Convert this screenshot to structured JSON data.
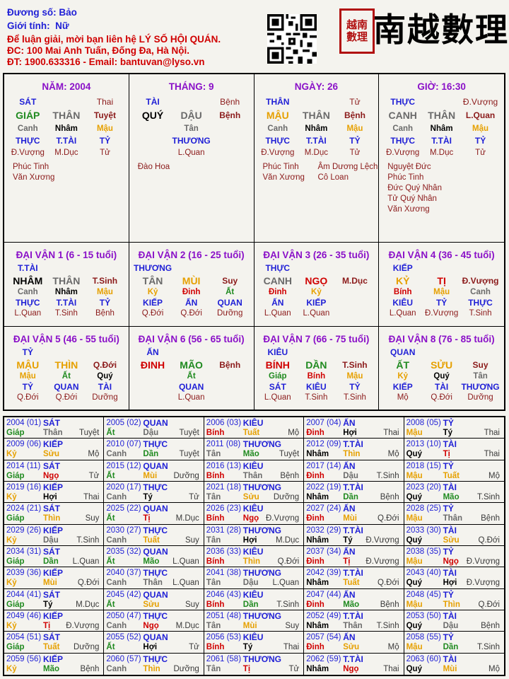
{
  "header": {
    "name_label": "Đương số:",
    "name": "Bảo",
    "gender_label": "Giới tính:",
    "gender": "Nữ",
    "contact1": "Để luận giải, mời bạn liên hệ LÝ SỐ HỘI QUÁN.",
    "contact2": "ĐC: 100 Mai Anh Tuấn, Đống Đa, Hà Nội.",
    "contact3": "ĐT: 1900.633316 - Email: bantuvan@lyso.vn",
    "brand": "南越數理",
    "seal": [
      "越南",
      "數理"
    ]
  },
  "pillars": [
    {
      "title": "NĂM: 2004",
      "row1": [
        {
          "t": "SÁT",
          "c": "c-blue b"
        },
        {
          "t": "",
          "c": ""
        },
        {
          "t": "Thai",
          "c": "c-maroon"
        }
      ],
      "row2": [
        {
          "t": "GIÁP",
          "c": "c-green b big"
        },
        {
          "t": "THÂN",
          "c": "c-gray b big"
        },
        {
          "t": "Tuyệt",
          "c": "c-maroon b"
        }
      ],
      "row3": [
        {
          "t": "Canh",
          "c": "c-gray b small"
        },
        {
          "t": "Nhâm",
          "c": "c-black b small"
        },
        {
          "t": "Mậu",
          "c": "c-orange b small"
        }
      ],
      "row4": [
        {
          "t": "THỰC",
          "c": "c-blue b"
        },
        {
          "t": "T.TÀI",
          "c": "c-blue b"
        },
        {
          "t": "TỶ",
          "c": "c-blue b"
        }
      ],
      "row5": [
        {
          "t": "Đ.Vượng",
          "c": "c-maroon small"
        },
        {
          "t": "M.Dục",
          "c": "c-maroon small"
        },
        {
          "t": "Tử",
          "c": "c-maroon small"
        }
      ],
      "stars_left": [
        "Phúc Tinh",
        "Văn Xương"
      ],
      "stars_right": []
    },
    {
      "title": "THÁNG: 9",
      "row1": [
        {
          "t": "TÀI",
          "c": "c-blue b"
        },
        {
          "t": "",
          "c": ""
        },
        {
          "t": "Bệnh",
          "c": "c-maroon"
        }
      ],
      "row2": [
        {
          "t": "QUÝ",
          "c": "c-black b big"
        },
        {
          "t": "DẬU",
          "c": "c-gray b big"
        },
        {
          "t": "Bệnh",
          "c": "c-maroon b"
        }
      ],
      "row3": [
        {
          "t": "",
          "c": ""
        },
        {
          "t": "Tân",
          "c": "c-gray b small"
        },
        {
          "t": "",
          "c": ""
        }
      ],
      "row4": [
        {
          "t": "",
          "c": ""
        },
        {
          "t": "THƯƠNG",
          "c": "c-blue b"
        },
        {
          "t": "",
          "c": ""
        }
      ],
      "row5": [
        {
          "t": "",
          "c": ""
        },
        {
          "t": "L.Quan",
          "c": "c-maroon small"
        },
        {
          "t": "",
          "c": ""
        }
      ],
      "stars_left": [
        "Đào Hoa"
      ],
      "stars_right": []
    },
    {
      "title": "NGÀY: 26",
      "row1": [
        {
          "t": "THÂN",
          "c": "c-blue b"
        },
        {
          "t": "",
          "c": ""
        },
        {
          "t": "Tử",
          "c": "c-maroon"
        }
      ],
      "row2": [
        {
          "t": "MẬU",
          "c": "c-orange b big"
        },
        {
          "t": "THÂN",
          "c": "c-gray b big"
        },
        {
          "t": "Bệnh",
          "c": "c-maroon b"
        }
      ],
      "row3": [
        {
          "t": "Canh",
          "c": "c-gray b small"
        },
        {
          "t": "Nhâm",
          "c": "c-black b small"
        },
        {
          "t": "Mậu",
          "c": "c-orange b small"
        }
      ],
      "row4": [
        {
          "t": "THỰC",
          "c": "c-blue b"
        },
        {
          "t": "T.TÀI",
          "c": "c-blue b"
        },
        {
          "t": "TỶ",
          "c": "c-blue b"
        }
      ],
      "row5": [
        {
          "t": "Đ.Vượng",
          "c": "c-maroon small"
        },
        {
          "t": "M.Dục",
          "c": "c-maroon small"
        },
        {
          "t": "Tử",
          "c": "c-maroon small"
        }
      ],
      "stars_left": [
        "Phúc Tinh",
        "Văn Xương"
      ],
      "stars_right": [
        "Âm Dương Lệch",
        "Cô Loan"
      ]
    },
    {
      "title": "GIỜ: 16:30",
      "row1": [
        {
          "t": "THỰC",
          "c": "c-blue b"
        },
        {
          "t": "",
          "c": ""
        },
        {
          "t": "Đ.Vượng",
          "c": "c-maroon"
        }
      ],
      "row2": [
        {
          "t": "CANH",
          "c": "c-gray b big"
        },
        {
          "t": "THÂN",
          "c": "c-gray b big"
        },
        {
          "t": "L.Quan",
          "c": "c-maroon b"
        }
      ],
      "row3": [
        {
          "t": "Canh",
          "c": "c-gray b small"
        },
        {
          "t": "Nhâm",
          "c": "c-black b small"
        },
        {
          "t": "Mậu",
          "c": "c-orange b small"
        }
      ],
      "row4": [
        {
          "t": "THỰC",
          "c": "c-blue b"
        },
        {
          "t": "T.TÀI",
          "c": "c-blue b"
        },
        {
          "t": "TỶ",
          "c": "c-blue b"
        }
      ],
      "row5": [
        {
          "t": "Đ.Vượng",
          "c": "c-maroon small"
        },
        {
          "t": "M.Dục",
          "c": "c-maroon small"
        },
        {
          "t": "Tử",
          "c": "c-maroon small"
        }
      ],
      "stars_left": [
        "Nguyệt Đức",
        "Phúc Tinh",
        "Đức Quý Nhân",
        "Tử Quý Nhân",
        "Văn Xương"
      ],
      "stars_right": []
    }
  ],
  "dai_van": [
    {
      "title": "ĐẠI VẬN 1 (6 - 15 tuổi)",
      "god": "T.TÀI",
      "row2": [
        {
          "t": "NHÂM",
          "c": "c-black b big"
        },
        {
          "t": "THÂN",
          "c": "c-gray b big"
        },
        {
          "t": "T.Sinh",
          "c": "c-maroon b"
        }
      ],
      "row3": [
        {
          "t": "Canh",
          "c": "c-gray b small"
        },
        {
          "t": "Nhâm",
          "c": "c-black b small"
        },
        {
          "t": "Mậu",
          "c": "c-orange b small"
        }
      ],
      "row4": [
        {
          "t": "THỰC",
          "c": "c-blue b"
        },
        {
          "t": "T.TÀI",
          "c": "c-blue b"
        },
        {
          "t": "TỶ",
          "c": "c-blue b"
        }
      ],
      "row5": [
        {
          "t": "L.Quan",
          "c": "c-maroon small"
        },
        {
          "t": "T.Sinh",
          "c": "c-maroon small"
        },
        {
          "t": "Bệnh",
          "c": "c-maroon small"
        }
      ]
    },
    {
      "title": "ĐẠI VẬN 2 (16 - 25 tuổi)",
      "god": "THƯƠNG",
      "row2": [
        {
          "t": "TÂN",
          "c": "c-gray b big"
        },
        {
          "t": "MÙI",
          "c": "c-orange b big"
        },
        {
          "t": "Suy",
          "c": "c-maroon b"
        }
      ],
      "row3": [
        {
          "t": "Kỷ",
          "c": "c-orange b small"
        },
        {
          "t": "Đinh",
          "c": "c-red b small"
        },
        {
          "t": "Ất",
          "c": "c-green b small"
        }
      ],
      "row4": [
        {
          "t": "KIẾP",
          "c": "c-blue b"
        },
        {
          "t": "ẤN",
          "c": "c-blue b"
        },
        {
          "t": "QUAN",
          "c": "c-blue b"
        }
      ],
      "row5": [
        {
          "t": "Q.Đới",
          "c": "c-maroon small"
        },
        {
          "t": "Q.Đới",
          "c": "c-maroon small"
        },
        {
          "t": "Dưỡng",
          "c": "c-maroon small"
        }
      ]
    },
    {
      "title": "ĐẠI VẬN 3 (26 - 35 tuổi)",
      "god": "THỰC",
      "row2": [
        {
          "t": "CANH",
          "c": "c-gray b big"
        },
        {
          "t": "NGỌ",
          "c": "c-red b big"
        },
        {
          "t": "M.Dục",
          "c": "c-maroon b"
        }
      ],
      "row3": [
        {
          "t": "Đinh",
          "c": "c-red b small"
        },
        {
          "t": "Kỷ",
          "c": "c-orange b small"
        },
        {
          "t": "",
          "c": ""
        }
      ],
      "row4": [
        {
          "t": "ẤN",
          "c": "c-blue b"
        },
        {
          "t": "KIẾP",
          "c": "c-blue b"
        },
        {
          "t": "",
          "c": ""
        }
      ],
      "row5": [
        {
          "t": "L.Quan",
          "c": "c-maroon small"
        },
        {
          "t": "L.Quan",
          "c": "c-maroon small"
        },
        {
          "t": "",
          "c": ""
        }
      ]
    },
    {
      "title": "ĐẠI VẬN 4 (36 - 45 tuổi)",
      "god": "KIẾP",
      "row2": [
        {
          "t": "KỶ",
          "c": "c-orange b big"
        },
        {
          "t": "TỊ",
          "c": "c-red b big"
        },
        {
          "t": "Đ.Vượng",
          "c": "c-maroon b"
        }
      ],
      "row3": [
        {
          "t": "Bính",
          "c": "c-red b small"
        },
        {
          "t": "Mậu",
          "c": "c-orange b small"
        },
        {
          "t": "Canh",
          "c": "c-gray b small"
        }
      ],
      "row4": [
        {
          "t": "KIÊU",
          "c": "c-blue b"
        },
        {
          "t": "TỶ",
          "c": "c-blue b"
        },
        {
          "t": "THỰC",
          "c": "c-blue b"
        }
      ],
      "row5": [
        {
          "t": "L.Quan",
          "c": "c-maroon small"
        },
        {
          "t": "Đ.Vượng",
          "c": "c-maroon small"
        },
        {
          "t": "T.Sinh",
          "c": "c-maroon small"
        }
      ]
    },
    {
      "title": "ĐẠI VẬN 5 (46 - 55 tuổi)",
      "god": "TỶ",
      "row2": [
        {
          "t": "MẬU",
          "c": "c-orange b big"
        },
        {
          "t": "THÌN",
          "c": "c-orange b big"
        },
        {
          "t": "Q.Đới",
          "c": "c-maroon b"
        }
      ],
      "row3": [
        {
          "t": "Mậu",
          "c": "c-orange b small"
        },
        {
          "t": "Ất",
          "c": "c-green b small"
        },
        {
          "t": "Quý",
          "c": "c-black b small"
        }
      ],
      "row4": [
        {
          "t": "TỶ",
          "c": "c-blue b"
        },
        {
          "t": "QUAN",
          "c": "c-blue b"
        },
        {
          "t": "TÀI",
          "c": "c-blue b"
        }
      ],
      "row5": [
        {
          "t": "Q.Đới",
          "c": "c-maroon small"
        },
        {
          "t": "Q.Đới",
          "c": "c-maroon small"
        },
        {
          "t": "Dưỡng",
          "c": "c-maroon small"
        }
      ]
    },
    {
      "title": "ĐẠI VẬN 6 (56 - 65 tuổi)",
      "god": "ẤN",
      "row2": [
        {
          "t": "ĐINH",
          "c": "c-red b big"
        },
        {
          "t": "MÃO",
          "c": "c-green b big"
        },
        {
          "t": "Bệnh",
          "c": "c-maroon b"
        }
      ],
      "row3": [
        {
          "t": "",
          "c": ""
        },
        {
          "t": "Ất",
          "c": "c-green b small"
        },
        {
          "t": "",
          "c": ""
        }
      ],
      "row4": [
        {
          "t": "",
          "c": ""
        },
        {
          "t": "QUAN",
          "c": "c-blue b"
        },
        {
          "t": "",
          "c": ""
        }
      ],
      "row5": [
        {
          "t": "",
          "c": ""
        },
        {
          "t": "L.Quan",
          "c": "c-maroon small"
        },
        {
          "t": "",
          "c": ""
        }
      ]
    },
    {
      "title": "ĐẠI VẬN 7 (66 - 75 tuổi)",
      "god": "KIÊU",
      "row2": [
        {
          "t": "BÍNH",
          "c": "c-red b big"
        },
        {
          "t": "DẦN",
          "c": "c-green b big"
        },
        {
          "t": "T.Sinh",
          "c": "c-maroon b"
        }
      ],
      "row3": [
        {
          "t": "Giáp",
          "c": "c-green b small"
        },
        {
          "t": "Bính",
          "c": "c-red b small"
        },
        {
          "t": "Mậu",
          "c": "c-orange b small"
        }
      ],
      "row4": [
        {
          "t": "SÁT",
          "c": "c-blue b"
        },
        {
          "t": "KIÊU",
          "c": "c-blue b"
        },
        {
          "t": "TỶ",
          "c": "c-blue b"
        }
      ],
      "row5": [
        {
          "t": "L.Quan",
          "c": "c-maroon small"
        },
        {
          "t": "T.Sinh",
          "c": "c-maroon small"
        },
        {
          "t": "T.Sinh",
          "c": "c-maroon small"
        }
      ]
    },
    {
      "title": "ĐẠI VẬN 8 (76 - 85 tuổi)",
      "god": "QUAN",
      "row2": [
        {
          "t": "ẤT",
          "c": "c-green b big"
        },
        {
          "t": "SỬU",
          "c": "c-orange b big"
        },
        {
          "t": "Suy",
          "c": "c-maroon b"
        }
      ],
      "row3": [
        {
          "t": "Kỷ",
          "c": "c-orange b small"
        },
        {
          "t": "Quý",
          "c": "c-black b small"
        },
        {
          "t": "Tân",
          "c": "c-gray b small"
        }
      ],
      "row4": [
        {
          "t": "KIẾP",
          "c": "c-blue b"
        },
        {
          "t": "TÀI",
          "c": "c-blue b"
        },
        {
          "t": "THƯƠNG",
          "c": "c-blue b"
        }
      ],
      "row5": [
        {
          "t": "Mộ",
          "c": "c-maroon small"
        },
        {
          "t": "Q.Đới",
          "c": "c-maroon small"
        },
        {
          "t": "Dưỡng",
          "c": "c-maroon small"
        }
      ]
    }
  ],
  "years": [
    [
      "2004 (01)",
      "SÁT",
      "Giáp",
      "Thân",
      "Tuyệt"
    ],
    [
      "2005 (02)",
      "QUAN",
      "Ất",
      "Dậu",
      "Tuyệt"
    ],
    [
      "2006 (03)",
      "KIÊU",
      "Bính",
      "Tuất",
      "Mộ"
    ],
    [
      "2007 (04)",
      "ẤN",
      "Đinh",
      "Hợi",
      "Thai"
    ],
    [
      "2008 (05)",
      "TỶ",
      "Mậu",
      "Tý",
      "Thai"
    ],
    [
      "2009 (06)",
      "KIẾP",
      "Kỷ",
      "Sửu",
      "Mộ"
    ],
    [
      "2010 (07)",
      "THỰC",
      "Canh",
      "Dần",
      "Tuyệt"
    ],
    [
      "2011 (08)",
      "THƯƠNG",
      "Tân",
      "Mão",
      "Tuyệt"
    ],
    [
      "2012 (09)",
      "T.TÀI",
      "Nhâm",
      "Thìn",
      "Mộ"
    ],
    [
      "2013 (10)",
      "TÀI",
      "Quý",
      "Tị",
      "Thai"
    ],
    [
      "2014 (11)",
      "SÁT",
      "Giáp",
      "Ngọ",
      "Tử"
    ],
    [
      "2015 (12)",
      "QUAN",
      "Ất",
      "Mùi",
      "Dưỡng"
    ],
    [
      "2016 (13)",
      "KIÊU",
      "Bính",
      "Thân",
      "Bệnh"
    ],
    [
      "2017 (14)",
      "ẤN",
      "Đinh",
      "Dậu",
      "T.Sinh"
    ],
    [
      "2018 (15)",
      "TỶ",
      "Mậu",
      "Tuất",
      "Mộ"
    ],
    [
      "2019 (16)",
      "KIẾP",
      "Kỷ",
      "Hợi",
      "Thai"
    ],
    [
      "2020 (17)",
      "THỰC",
      "Canh",
      "Tý",
      "Tử"
    ],
    [
      "2021 (18)",
      "THƯƠNG",
      "Tân",
      "Sửu",
      "Dưỡng"
    ],
    [
      "2022 (19)",
      "T.TÀI",
      "Nhâm",
      "Dần",
      "Bệnh"
    ],
    [
      "2023 (20)",
      "TÀI",
      "Quý",
      "Mão",
      "T.Sinh"
    ],
    [
      "2024 (21)",
      "SÁT",
      "Giáp",
      "Thìn",
      "Suy"
    ],
    [
      "2025 (22)",
      "QUAN",
      "Ất",
      "Tị",
      "M.Dục"
    ],
    [
      "2026 (23)",
      "KIÊU",
      "Bính",
      "Ngọ",
      "Đ.Vượng"
    ],
    [
      "2027 (24)",
      "ẤN",
      "Đinh",
      "Mùi",
      "Q.Đới"
    ],
    [
      "2028 (25)",
      "TỶ",
      "Mậu",
      "Thân",
      "Bệnh"
    ],
    [
      "2029 (26)",
      "KIẾP",
      "Kỷ",
      "Dậu",
      "T.Sinh"
    ],
    [
      "2030 (27)",
      "THỰC",
      "Canh",
      "Tuất",
      "Suy"
    ],
    [
      "2031 (28)",
      "THƯƠNG",
      "Tân",
      "Hợi",
      "M.Dục"
    ],
    [
      "2032 (29)",
      "T.TÀI",
      "Nhâm",
      "Tý",
      "Đ.Vượng"
    ],
    [
      "2033 (30)",
      "TÀI",
      "Quý",
      "Sửu",
      "Q.Đới"
    ],
    [
      "2034 (31)",
      "SÁT",
      "Giáp",
      "Dần",
      "L.Quan"
    ],
    [
      "2035 (32)",
      "QUAN",
      "Ất",
      "Mão",
      "L.Quan"
    ],
    [
      "2036 (33)",
      "KIÊU",
      "Bính",
      "Thìn",
      "Q.Đới"
    ],
    [
      "2037 (34)",
      "ẤN",
      "Đinh",
      "Tị",
      "Đ.Vượng"
    ],
    [
      "2038 (35)",
      "TỶ",
      "Mậu",
      "Ngọ",
      "Đ.Vượng"
    ],
    [
      "2039 (36)",
      "KIẾP",
      "Kỷ",
      "Mùi",
      "Q.Đới"
    ],
    [
      "2040 (37)",
      "THỰC",
      "Canh",
      "Thân",
      "L.Quan"
    ],
    [
      "2041 (38)",
      "THƯƠNG",
      "Tân",
      "Dậu",
      "L.Quan"
    ],
    [
      "2042 (39)",
      "T.TÀI",
      "Nhâm",
      "Tuất",
      "Q.Đới"
    ],
    [
      "2043 (40)",
      "TÀI",
      "Quý",
      "Hợi",
      "Đ.Vượng"
    ],
    [
      "2044 (41)",
      "SÁT",
      "Giáp",
      "Tý",
      "M.Dục"
    ],
    [
      "2045 (42)",
      "QUAN",
      "Ất",
      "Sửu",
      "Suy"
    ],
    [
      "2046 (43)",
      "KIÊU",
      "Bính",
      "Dần",
      "T.Sinh"
    ],
    [
      "2047 (44)",
      "ẤN",
      "Đinh",
      "Mão",
      "Bệnh"
    ],
    [
      "2048 (45)",
      "TỶ",
      "Mậu",
      "Thìn",
      "Q.Đới"
    ],
    [
      "2049 (46)",
      "KIẾP",
      "Kỷ",
      "Tị",
      "Đ.Vượng"
    ],
    [
      "2050 (47)",
      "THỰC",
      "Canh",
      "Ngọ",
      "M.Dục"
    ],
    [
      "2051 (48)",
      "THƯƠNG",
      "Tân",
      "Mùi",
      "Suy"
    ],
    [
      "2052 (49)",
      "T.TÀI",
      "Nhâm",
      "Thân",
      "T.Sinh"
    ],
    [
      "2053 (50)",
      "TÀI",
      "Quý",
      "Dậu",
      "Bệnh"
    ],
    [
      "2054 (51)",
      "SÁT",
      "Giáp",
      "Tuất",
      "Dưỡng"
    ],
    [
      "2055 (52)",
      "QUAN",
      "Ất",
      "Hợi",
      "Tử"
    ],
    [
      "2056 (53)",
      "KIÊU",
      "Bính",
      "Tý",
      "Thai"
    ],
    [
      "2057 (54)",
      "ẤN",
      "Đinh",
      "Sửu",
      "Mộ"
    ],
    [
      "2058 (55)",
      "TỶ",
      "Mậu",
      "Dần",
      "T.Sinh"
    ],
    [
      "2059 (56)",
      "KIẾP",
      "Kỷ",
      "Mão",
      "Bệnh"
    ],
    [
      "2060 (57)",
      "THỰC",
      "Canh",
      "Thìn",
      "Dưỡng"
    ],
    [
      "2061 (58)",
      "THƯƠNG",
      "Tân",
      "Tị",
      "Tử"
    ],
    [
      "2062 (59)",
      "T.TÀI",
      "Nhâm",
      "Ngọ",
      "Thai"
    ],
    [
      "2063 (60)",
      "TÀI",
      "Quý",
      "Mùi",
      "Mộ"
    ]
  ],
  "stem_colors": {
    "Giáp": "#1f8a1f",
    "Ất": "#1f8a1f",
    "Bính": "#d00000",
    "Đinh": "#d00000",
    "Mậu": "#e6a000",
    "Kỷ": "#e6a000",
    "Canh": "#6a6a6a",
    "Tân": "#6a6a6a",
    "Nhâm": "#000000",
    "Quý": "#000000"
  },
  "branch_colors": {
    "Tý": "#000000",
    "Hợi": "#000000",
    "Dần": "#1f8a1f",
    "Mão": "#1f8a1f",
    "Tị": "#d00000",
    "Ngọ": "#d00000",
    "Thân": "#6a6a6a",
    "Dậu": "#6a6a6a",
    "Thìn": "#e6a000",
    "Tuất": "#e6a000",
    "Sửu": "#e6a000",
    "Mùi": "#e6a000"
  }
}
